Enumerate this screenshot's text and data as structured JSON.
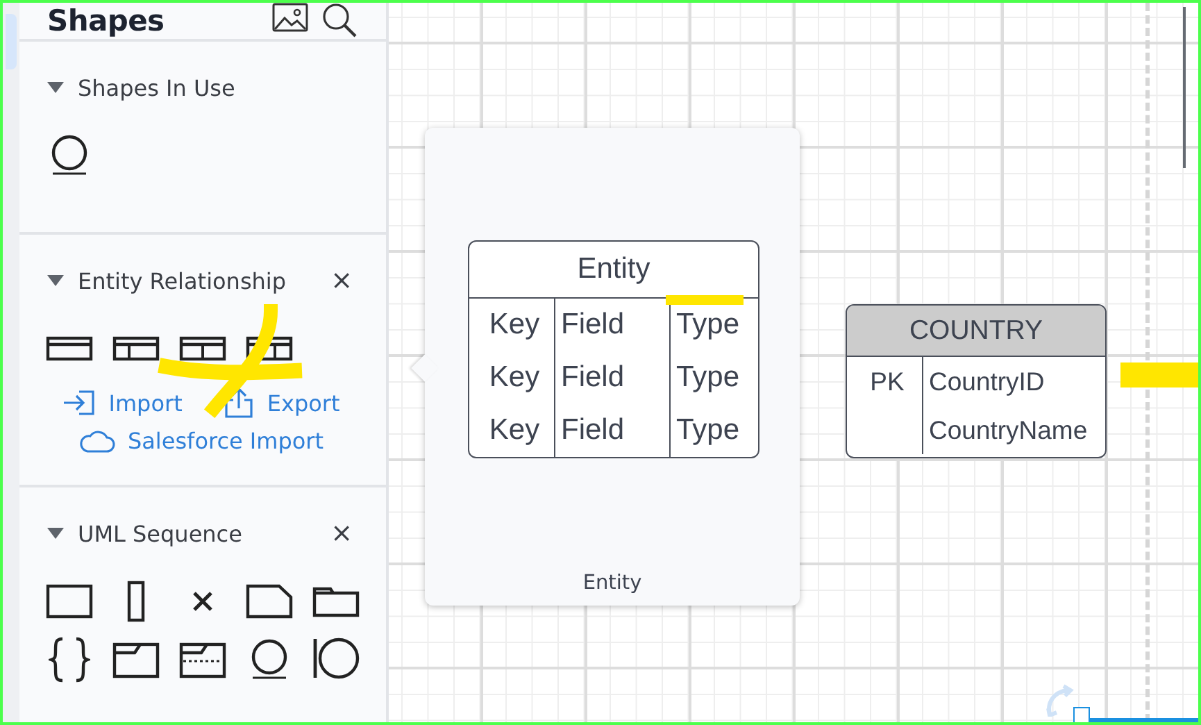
{
  "sidebar": {
    "title": "Shapes",
    "sections": [
      {
        "title": "Shapes In Use",
        "expanded": true,
        "shapes": [
          {
            "kind": "circle-underline"
          }
        ]
      },
      {
        "title": "Entity Relationship",
        "expanded": true,
        "close": "×",
        "shapes": [
          {
            "kind": "er-header"
          },
          {
            "kind": "er-two"
          },
          {
            "kind": "er-split"
          },
          {
            "kind": "er-three"
          }
        ],
        "links": [
          {
            "label": "Import",
            "kind": "import"
          },
          {
            "label": "Export",
            "kind": "export"
          },
          {
            "label": "Salesforce Import",
            "kind": "cloud"
          }
        ]
      },
      {
        "title": "UML Sequence",
        "expanded": true,
        "close": "×",
        "shapes": [
          {
            "kind": "rect"
          },
          {
            "kind": "tall-rect"
          },
          {
            "kind": "x-mark"
          },
          {
            "kind": "note"
          },
          {
            "kind": "folder"
          },
          {
            "kind": "braces"
          },
          {
            "kind": "frame"
          },
          {
            "kind": "frame-dotted"
          },
          {
            "kind": "circle-underline"
          },
          {
            "kind": "circle-bar"
          }
        ]
      }
    ]
  },
  "preview": {
    "caption": "Entity",
    "entity": {
      "title": "Entity",
      "rows": [
        {
          "key": "Key",
          "field": "Field",
          "type": "Type"
        },
        {
          "key": "Key",
          "field": "Field",
          "type": "Type"
        },
        {
          "key": "Key",
          "field": "Field",
          "type": "Type"
        }
      ]
    }
  },
  "canvas": {
    "table": {
      "title": "COUNTRY",
      "rows": [
        {
          "key": "PK",
          "field": "CountryID"
        },
        {
          "field": "CountryName"
        }
      ]
    }
  }
}
